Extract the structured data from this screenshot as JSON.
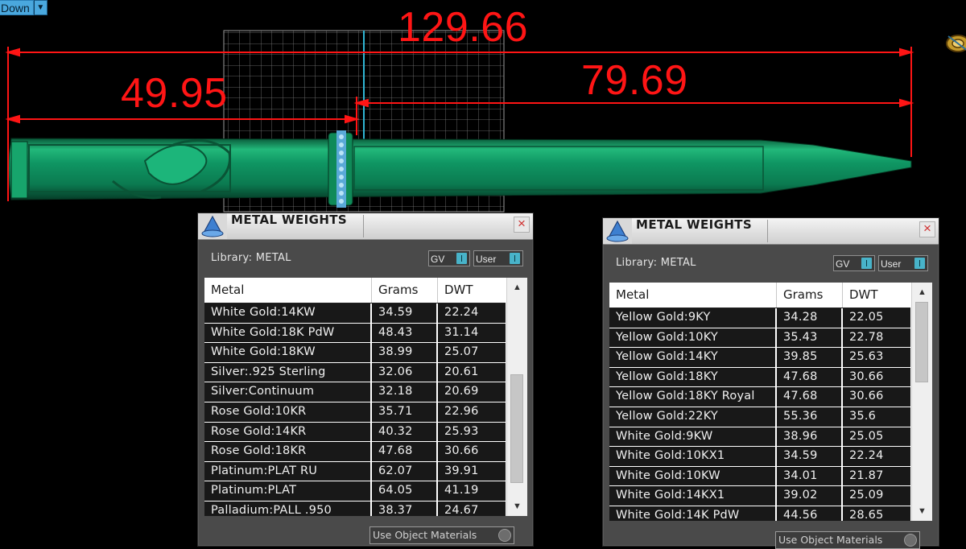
{
  "toolbar": {
    "combo_value": "Down"
  },
  "dimensions": {
    "overall": "129.66",
    "left": "49.95",
    "right": "79.69"
  },
  "colors": {
    "dimension": "#ff1515",
    "model": "#0f8a58",
    "panel_bg": "#4a4a4a",
    "toggle_knob": "#48b3c9"
  },
  "panels": [
    {
      "title": "METAL WEIGHTS",
      "library_label": "Library: METAL",
      "gv_label": "GV",
      "user_label": "User",
      "columns": [
        "Metal",
        "Grams",
        "DWT"
      ],
      "rows": [
        [
          "White Gold:14KW",
          "34.59",
          "22.24"
        ],
        [
          "White Gold:18K PdW",
          "48.43",
          "31.14"
        ],
        [
          "White Gold:18KW",
          "38.99",
          "25.07"
        ],
        [
          "Silver:.925 Sterling",
          "32.06",
          "20.61"
        ],
        [
          "Silver:Continuum",
          "32.18",
          "20.69"
        ],
        [
          "Rose Gold:10KR",
          "35.71",
          "22.96"
        ],
        [
          "Rose Gold:14KR",
          "40.32",
          "25.93"
        ],
        [
          "Rose Gold:18KR",
          "47.68",
          "30.66"
        ],
        [
          "Platinum:PLAT RU",
          "62.07",
          "39.91"
        ],
        [
          "Platinum:PLAT",
          "64.05",
          "41.19"
        ],
        [
          "Palladium:PALL .950",
          "38.37",
          "24.67"
        ]
      ],
      "use_object_materials": "Use Object Materials"
    },
    {
      "title": "METAL WEIGHTS",
      "library_label": "Library: METAL",
      "gv_label": "GV",
      "user_label": "User",
      "columns": [
        "Metal",
        "Grams",
        "DWT"
      ],
      "rows": [
        [
          "Yellow Gold:9KY",
          "34.28",
          "22.05"
        ],
        [
          "Yellow Gold:10KY",
          "35.43",
          "22.78"
        ],
        [
          "Yellow Gold:14KY",
          "39.85",
          "25.63"
        ],
        [
          "Yellow Gold:18KY",
          "47.68",
          "30.66"
        ],
        [
          "Yellow Gold:18KY Royal",
          "47.68",
          "30.66"
        ],
        [
          "Yellow Gold:22KY",
          "55.36",
          "35.6"
        ],
        [
          "White Gold:9KW",
          "38.96",
          "25.05"
        ],
        [
          "White Gold:10KX1",
          "34.59",
          "22.24"
        ],
        [
          "White Gold:10KW",
          "34.01",
          "21.87"
        ],
        [
          "White Gold:14KX1",
          "39.02",
          "25.09"
        ],
        [
          "White Gold:14K PdW",
          "44.56",
          "28.65"
        ]
      ],
      "use_object_materials": "Use Object Materials"
    }
  ]
}
